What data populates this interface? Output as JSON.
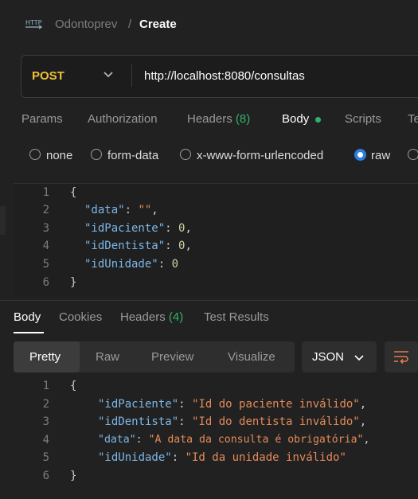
{
  "header": {
    "icon_text": "HTTP",
    "parent": "Odontoprev",
    "separator": "/",
    "current": "Create"
  },
  "request": {
    "method": "POST",
    "url": "http://localhost:8080/consultas"
  },
  "request_tabs": {
    "params": "Params",
    "authorization": "Authorization",
    "headers": "Headers",
    "headers_count": "(8)",
    "body": "Body",
    "scripts": "Scripts",
    "tests_partial": "Te"
  },
  "body_types": {
    "none": "none",
    "form_data": "form-data",
    "urlencoded": "x-www-form-urlencoded",
    "raw": "raw",
    "selected": "raw"
  },
  "request_body": {
    "line_numbers": [
      "1",
      "2",
      "3",
      "4",
      "5",
      "6"
    ],
    "open": "{",
    "close": "}",
    "k1": "\"data\"",
    "v1": "\"\"",
    "k2": "\"idPaciente\"",
    "v2": "0",
    "k3": "\"idDentista\"",
    "v3": "0",
    "k4": "\"idUnidade\"",
    "v4": "0"
  },
  "response_tabs": {
    "body": "Body",
    "cookies": "Cookies",
    "headers": "Headers",
    "headers_count": "(4)",
    "test_results": "Test Results"
  },
  "view_modes": {
    "pretty": "Pretty",
    "raw": "Raw",
    "preview": "Preview",
    "visualize": "Visualize",
    "format": "JSON"
  },
  "response_body": {
    "line_numbers": [
      "1",
      "2",
      "3",
      "4",
      "5",
      "6"
    ],
    "open": "{",
    "close": "}",
    "k1": "\"idPaciente\"",
    "v1": "\"Id do paciente inválido\"",
    "k2": "\"idDentista\"",
    "v2": "\"Id do dentista inválido\"",
    "k3": "\"data\"",
    "v3": "\"A data da consulta é obrigatória\"",
    "k4": "\"idUnidade\"",
    "v4": "\"Id da unidade inválido\""
  },
  "colors": {
    "method": "#f2c037",
    "accent_green": "#2fb26b",
    "radio_selected": "#2a7de1",
    "json_key": "#7cb7e8",
    "json_string": "#e58a5a"
  }
}
